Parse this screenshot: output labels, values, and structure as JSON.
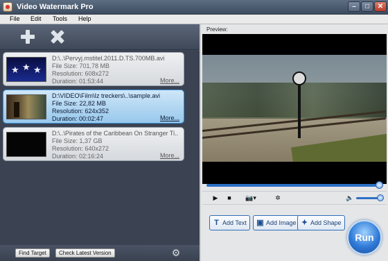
{
  "window": {
    "title": "Video Watermark Pro"
  },
  "menu": [
    "File",
    "Edit",
    "Tools",
    "Help"
  ],
  "files": [
    {
      "name": "D:\\..\\Pervyj.mstitel.2011.D.TS.700MB.avi",
      "size": "File Size: 701,78 MB",
      "resolution": "Resolution: 608x272",
      "duration": "Duration: 01:53:44",
      "more": "More...",
      "selected": false,
      "thumb": "stars"
    },
    {
      "name": "D:\\VIDEO\\Film\\Iz treckers\\..\\sample.avi",
      "size": "File Size: 22,82 MB",
      "resolution": "Resolution: 624x352",
      "duration": "Duration: 00:02:47",
      "more": "More...",
      "selected": true,
      "thumb": "scene"
    },
    {
      "name": "D:\\..\\Pirates of the Caribbean On Stranger Ti..",
      "size": "File Size: 1,37 GB",
      "resolution": "Resolution: 640x272",
      "duration": "Duration: 02:16:24",
      "more": "More...",
      "selected": false,
      "thumb": "dark"
    }
  ],
  "bottom": {
    "find_target": "Find Target",
    "check_version": "Check Latest Version"
  },
  "preview": {
    "label": "Preview:",
    "seek_fraction": 0.98,
    "volume_fraction": 0.9
  },
  "actions": {
    "add_text": "Add Text",
    "add_image": "Add Image",
    "add_shape": "Add Shape",
    "run": "Run"
  },
  "colors": {
    "accent": "#2c6fc4",
    "selected_bg": "#98c8ec"
  }
}
